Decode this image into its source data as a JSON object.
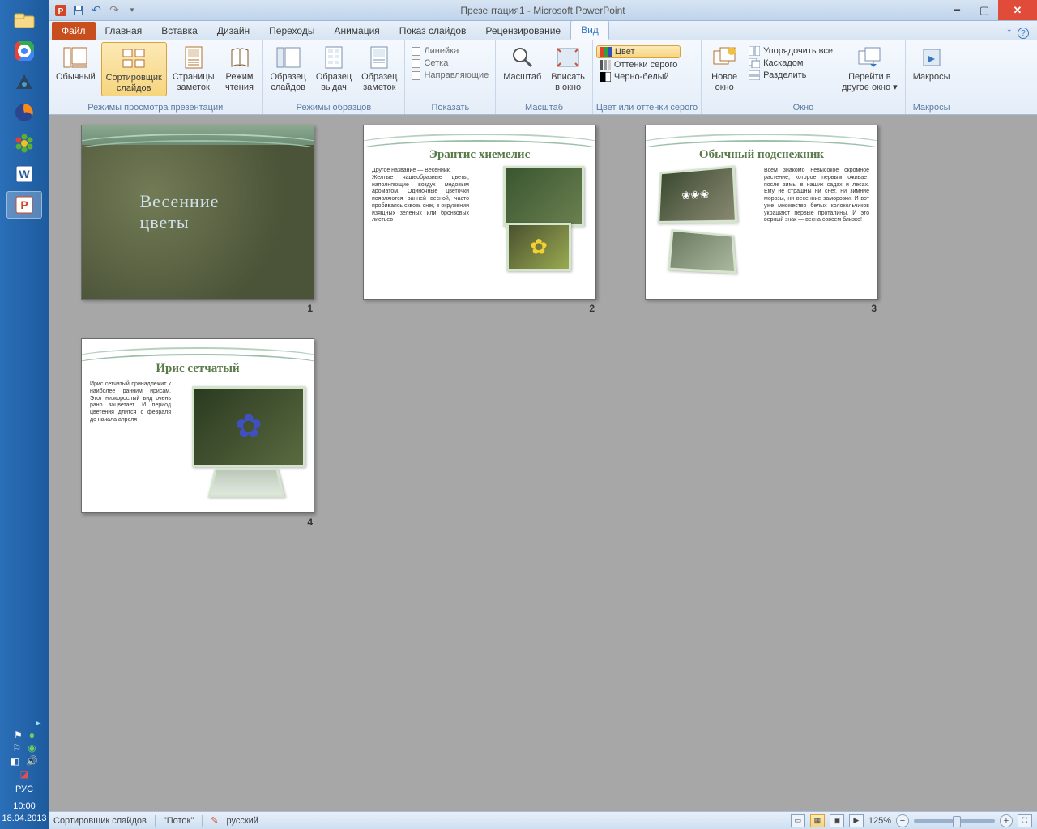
{
  "taskbar": {
    "lang": "РУС",
    "time": "10:00",
    "date": "18.04.2013"
  },
  "titlebar": {
    "title": "Презентация1 - Microsoft PowerPoint"
  },
  "tabs": {
    "file": "Файл",
    "home": "Главная",
    "insert": "Вставка",
    "design": "Дизайн",
    "transitions": "Переходы",
    "animation": "Анимация",
    "slideshow": "Показ слайдов",
    "review": "Рецензирование",
    "view": "Вид"
  },
  "ribbon": {
    "normal": "Обычный",
    "sorter": "Сортировщик\nслайдов",
    "notes_page": "Страницы\nзаметок",
    "reading": "Режим\nчтения",
    "g_views": "Режимы просмотра презентации",
    "master_slide": "Образец\nслайдов",
    "master_handout": "Образец\nвыдач",
    "master_notes": "Образец\nзаметок",
    "g_masters": "Режимы образцов",
    "ruler": "Линейка",
    "grid": "Сетка",
    "guides": "Направляющие",
    "g_show": "Показать",
    "zoom": "Масштаб",
    "fit": "Вписать\nв окно",
    "g_zoom": "Масштаб",
    "color": "Цвет",
    "gray": "Оттенки серого",
    "bw": "Черно-белый",
    "g_color": "Цвет или оттенки серого",
    "new_window": "Новое\nокно",
    "arrange_all": "Упорядочить все",
    "cascade": "Каскадом",
    "split": "Разделить",
    "g_window": "Окно",
    "switch": "Перейти в\nдругое окно",
    "macros": "Макросы",
    "g_macros": "Макросы"
  },
  "slides": {
    "s1": {
      "num": "1",
      "title": "Весенние цветы"
    },
    "s2": {
      "num": "2",
      "title": "Эрантис хиемелис",
      "body": "Другое название — Весенник.\nЖелтые чашеобразные цветы, наполняющие воздух медовым ароматом. Одиночные цветочки появляются ранней весной, часто пробиваясь сквозь снег, в окружении изящных зеленых или бронзовых листьев"
    },
    "s3": {
      "num": "3",
      "title": "Обычный подснежник",
      "body": "Всем знакомо невысокое скромное растение, которое первым оживает после зимы в наших садах и лесах. Ему не страшны ни снег, ни зимние морозы, ни весенние заморозки. И вот уже множество белых колокольчиков украшают первые проталины. И это верный знак — весна совсем близко!"
    },
    "s4": {
      "num": "4",
      "title": "Ирис сетчатый",
      "body": "Ирис сетчатый принадлежит к наиболее ранним ирисам. Этот низкорослый вид очень рано зацветает. И период цветения длится с февраля до начала апреля"
    }
  },
  "status": {
    "mode": "Сортировщик слайдов",
    "theme": "\"Поток\"",
    "lang": "русский",
    "zoom": "125%"
  }
}
